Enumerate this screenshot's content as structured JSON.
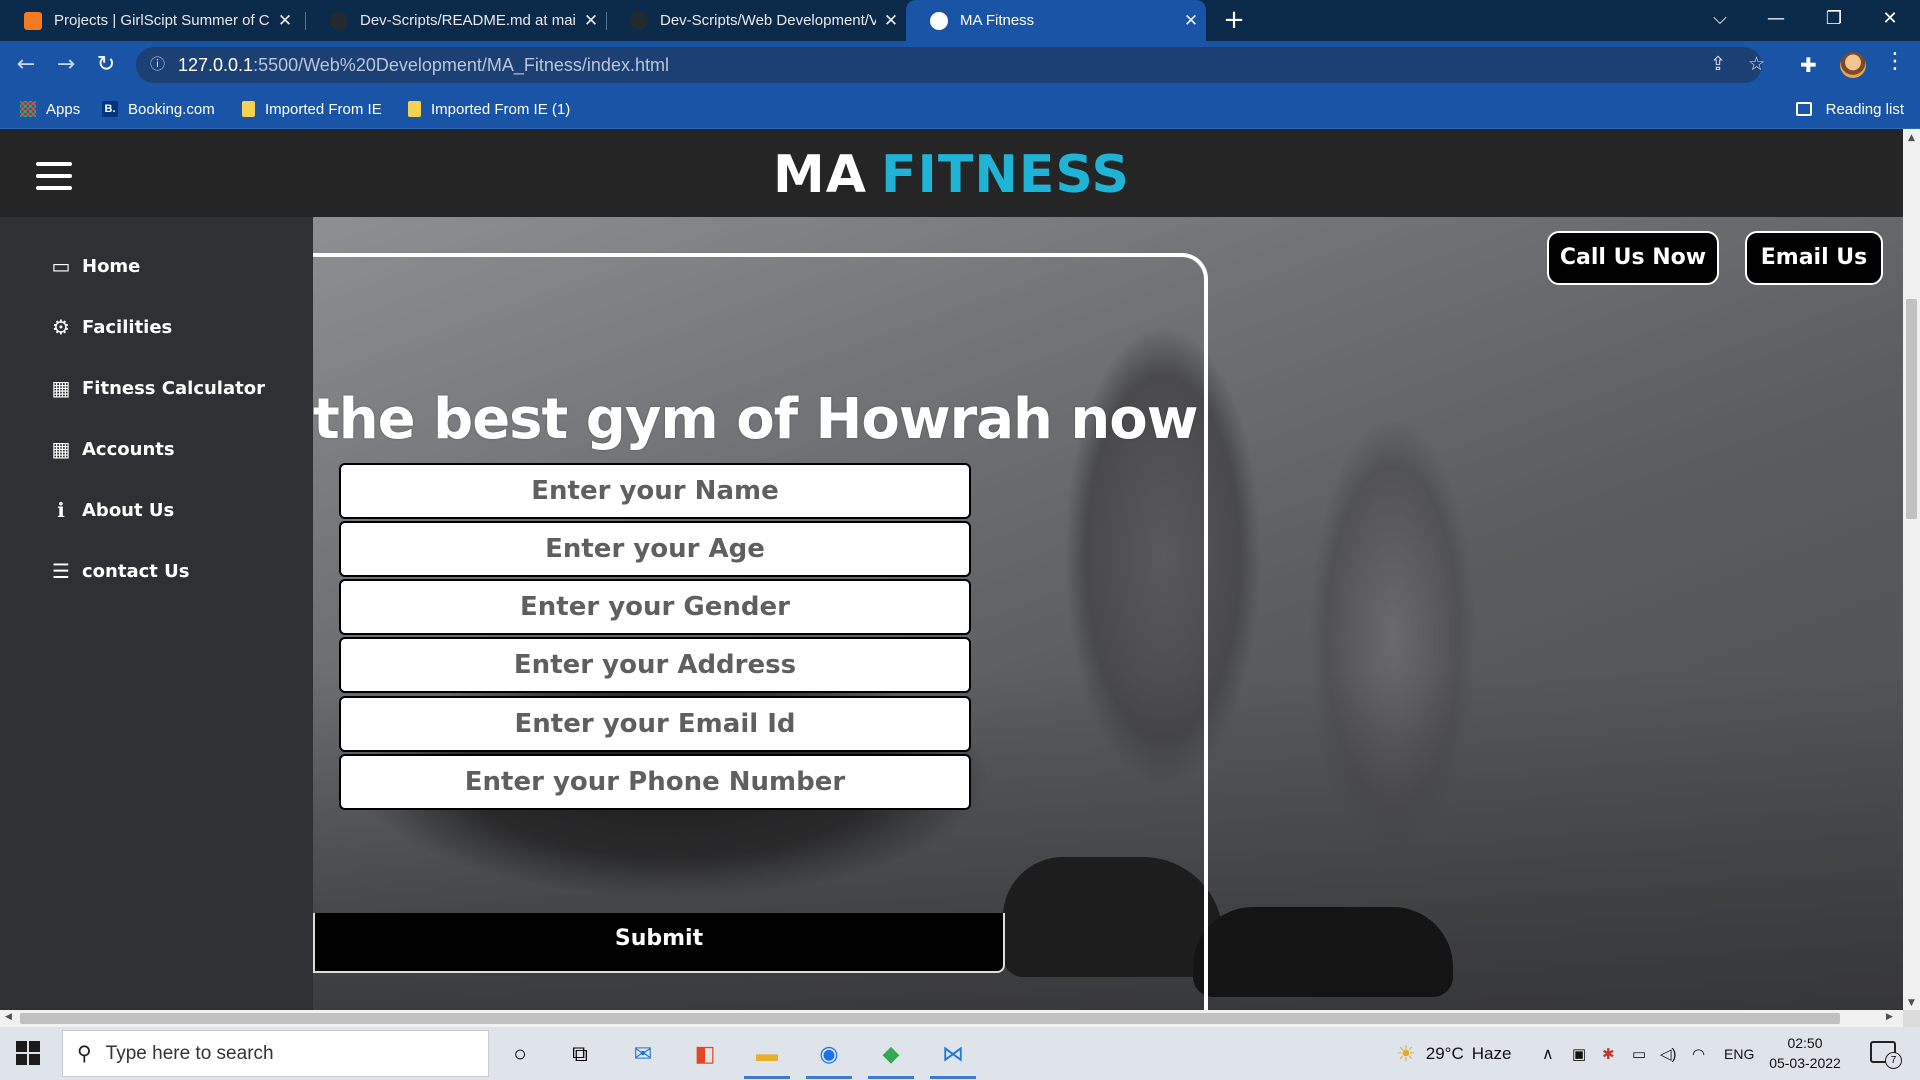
{
  "browser": {
    "tabs": [
      {
        "title": "Projects | GirlScipt Summer of Co",
        "favicon_color": "#f47b20",
        "active": false
      },
      {
        "title": "Dev-Scripts/README.md at main",
        "favicon_color": "#24292f",
        "active": false
      },
      {
        "title": "Dev-Scripts/Web Development/V",
        "favicon_color": "#24292f",
        "active": false
      },
      {
        "title": "MA Fitness",
        "favicon_color": "#ffffff",
        "active": true
      }
    ],
    "new_tab_glyph": "+",
    "window_controls": {
      "dropdown": "⌵",
      "minimize": "—",
      "restore": "❐",
      "close": "✕"
    },
    "address": {
      "host": "127.0.0.1",
      "path": ":5500/Web%20Development/MA_Fitness/index.html"
    },
    "bookmarks": [
      {
        "label": "Apps",
        "icon": "apps-grid-icon"
      },
      {
        "label": "Booking.com",
        "icon": "booking-icon",
        "badge": "B."
      },
      {
        "label": "Imported From IE",
        "icon": "folder-icon"
      },
      {
        "label": "Imported From IE (1)",
        "icon": "folder-icon"
      }
    ],
    "reading_list": "Reading list"
  },
  "site": {
    "logo_part1": "MA",
    "logo_part2": "FITNESS",
    "brand_colors": {
      "accent": "#1fb3d6",
      "header_bg": "#252526",
      "sidebar_bg": "#2f3033"
    },
    "nav": [
      {
        "label": "Home",
        "icon": "monitor-icon",
        "glyph": "▭"
      },
      {
        "label": "Facilities",
        "icon": "gears-icon",
        "glyph": "⚙"
      },
      {
        "label": "Fitness Calculator",
        "icon": "table-icon",
        "glyph": "▦"
      },
      {
        "label": "Accounts",
        "icon": "grid-icon",
        "glyph": "▦"
      },
      {
        "label": "About Us",
        "icon": "info-icon",
        "glyph": "ℹ"
      },
      {
        "label": "contact Us",
        "icon": "sliders-icon",
        "glyph": "☰"
      }
    ],
    "call_button": "Call Us Now",
    "email_button": "Email Us",
    "tagline": "the best gym of Howrah now",
    "form": {
      "name_placeholder": "Enter your Name",
      "age_placeholder": "Enter your Age",
      "gender_placeholder": "Enter your Gender",
      "address_placeholder": "Enter your Address",
      "email_placeholder": "Enter your Email Id",
      "phone_placeholder": "Enter your Phone Number",
      "submit_label": "Submit"
    }
  },
  "taskbar": {
    "search_placeholder": "Type here to search",
    "weather_temp": "29°C",
    "weather_text": "Haze",
    "language": "ENG",
    "time": "02:50",
    "date": "05-03-2022",
    "notification_count": "7"
  }
}
